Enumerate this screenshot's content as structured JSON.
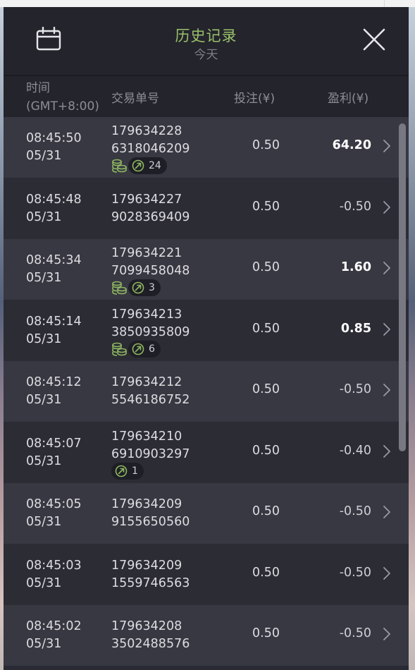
{
  "header": {
    "title": "历史记录",
    "subtitle": "今天"
  },
  "columns": {
    "time_line1": "时间",
    "time_line2": "(GMT+8:00)",
    "order": "交易单号",
    "bet": "投注(¥)",
    "profit": "盈利(¥)"
  },
  "colors": {
    "title": "#9ac06a",
    "icon_green": "#8fb860",
    "positive_profit": "#ffffff",
    "negative_profit": "#cfcfd4"
  },
  "rows": [
    {
      "time": "08:45:50",
      "date": "05/31",
      "id1": "179634228",
      "id2": "6318046209",
      "bet": "0.50",
      "profit": "64.20",
      "positive": true,
      "coins": true,
      "feature": "24"
    },
    {
      "time": "08:45:48",
      "date": "05/31",
      "id1": "179634227",
      "id2": "9028369409",
      "bet": "0.50",
      "profit": "-0.50",
      "positive": false,
      "coins": false,
      "feature": null
    },
    {
      "time": "08:45:34",
      "date": "05/31",
      "id1": "179634221",
      "id2": "7099458048",
      "bet": "0.50",
      "profit": "1.60",
      "positive": true,
      "coins": true,
      "feature": "3"
    },
    {
      "time": "08:45:14",
      "date": "05/31",
      "id1": "179634213",
      "id2": "3850935809",
      "bet": "0.50",
      "profit": "0.85",
      "positive": true,
      "coins": true,
      "feature": "6"
    },
    {
      "time": "08:45:12",
      "date": "05/31",
      "id1": "179634212",
      "id2": "5546186752",
      "bet": "0.50",
      "profit": "-0.50",
      "positive": false,
      "coins": false,
      "feature": null
    },
    {
      "time": "08:45:07",
      "date": "05/31",
      "id1": "179634210",
      "id2": "6910903297",
      "bet": "0.50",
      "profit": "-0.40",
      "positive": false,
      "coins": false,
      "feature": "1"
    },
    {
      "time": "08:45:05",
      "date": "05/31",
      "id1": "179634209",
      "id2": "9155650560",
      "bet": "0.50",
      "profit": "-0.50",
      "positive": false,
      "coins": false,
      "feature": null
    },
    {
      "time": "08:45:03",
      "date": "05/31",
      "id1": "179634209",
      "id2": "1559746563",
      "bet": "0.50",
      "profit": "-0.50",
      "positive": false,
      "coins": false,
      "feature": null
    },
    {
      "time": "08:45:02",
      "date": "05/31",
      "id1": "179634208",
      "id2": "3502488576",
      "bet": "0.50",
      "profit": "-0.50",
      "positive": false,
      "coins": false,
      "feature": null
    }
  ],
  "icons": {
    "calendar": "calendar-icon",
    "close": "close-icon",
    "coins": "coins-icon",
    "feature": "arrow-circle-icon",
    "chevron": "chevron-right-icon"
  }
}
